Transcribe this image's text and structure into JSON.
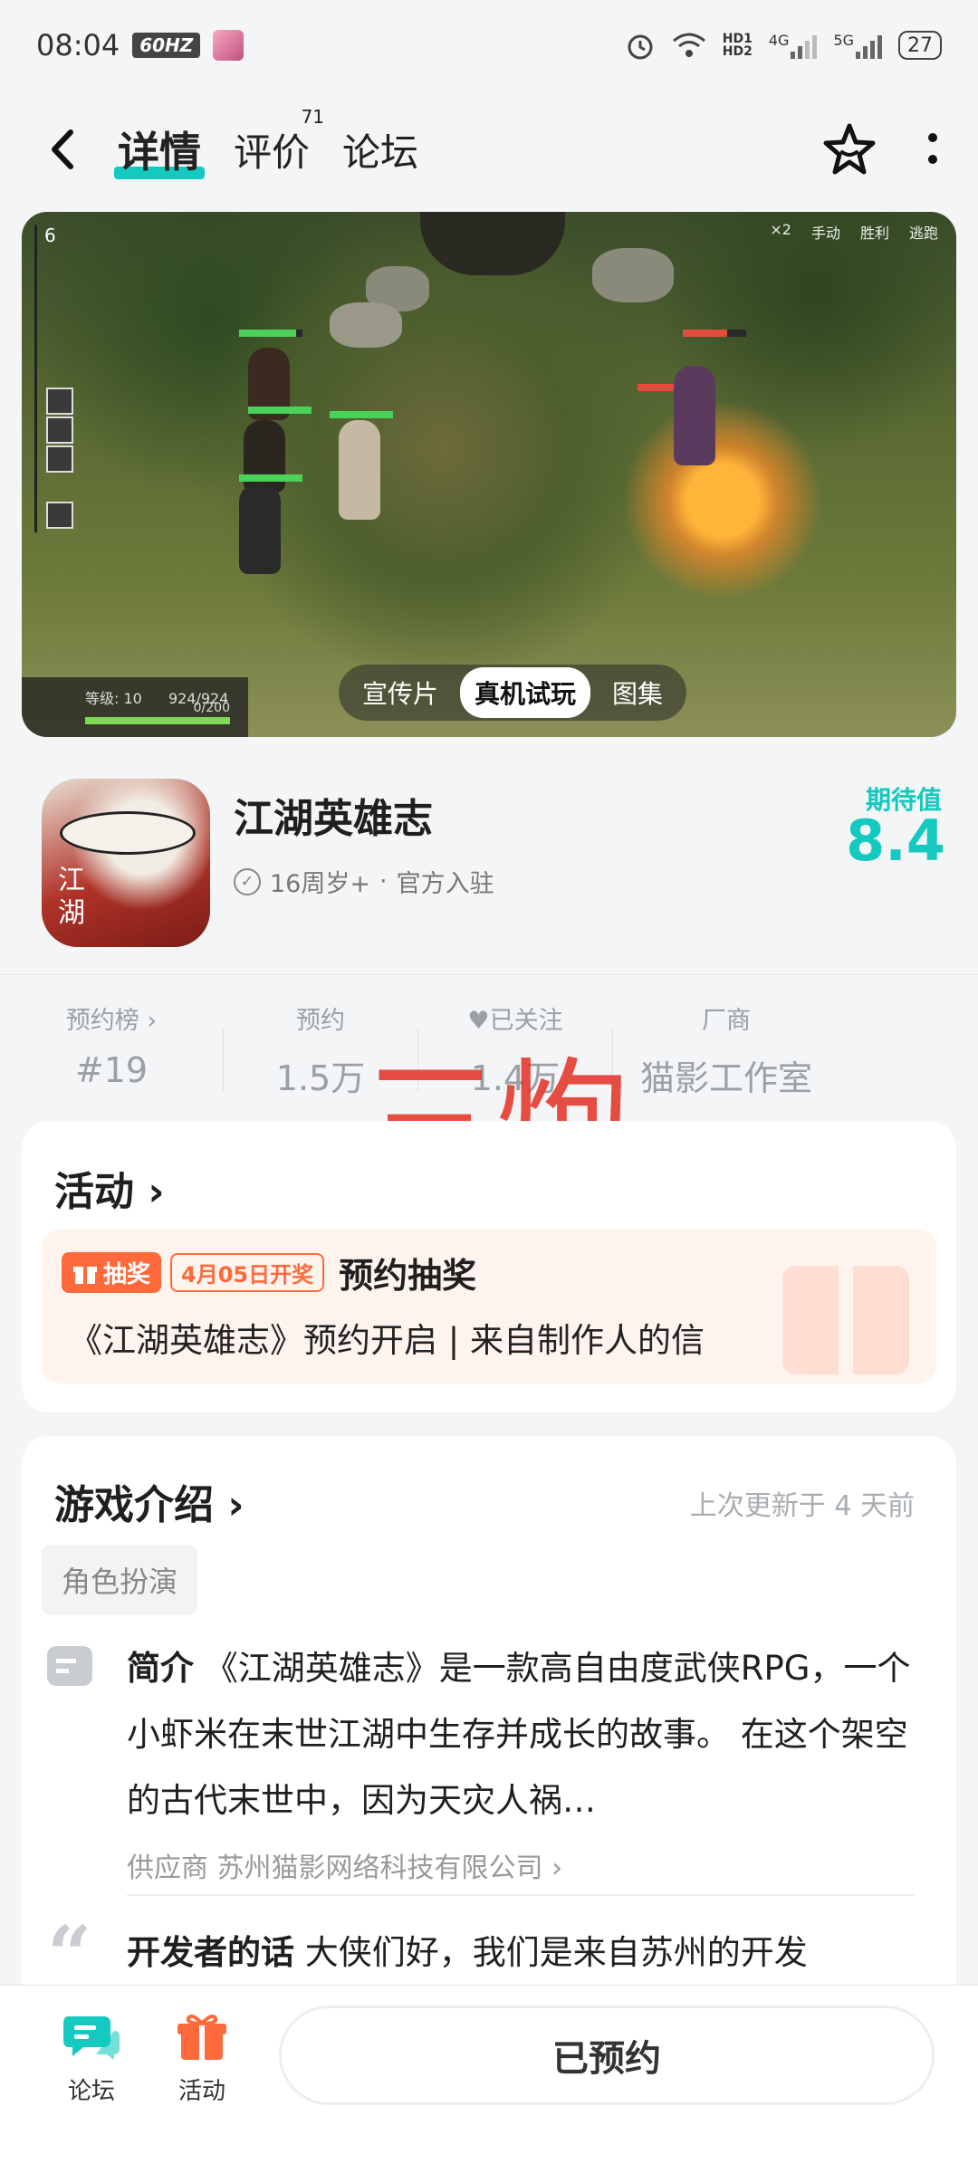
{
  "status_bar": {
    "time": "08:04",
    "refresh_rate": "60HZ",
    "network_1": "4G",
    "network_2": "5G",
    "hd_1": "HD1",
    "hd_2": "HD2",
    "battery": "27"
  },
  "nav": {
    "tabs": [
      {
        "label": "详情",
        "active": true
      },
      {
        "label": "评价",
        "badge": "71"
      },
      {
        "label": "论坛"
      }
    ]
  },
  "banner": {
    "media_tabs": [
      "宣传片",
      "真机试玩",
      "图集"
    ],
    "active_media_tab": "真机试玩",
    "hud": {
      "wave": "6",
      "top_stats": [
        "×2",
        "手动",
        "胜利",
        "逃跑"
      ],
      "level_label": "等级: 10",
      "hp": "924/924",
      "xp": "0/200"
    }
  },
  "app": {
    "title": "江湖英雄志",
    "icon_text": "江湖",
    "age_rating": "16周岁+",
    "separator": "·",
    "official": "官方入驻",
    "rating_label": "期待值",
    "rating_value": "8.4",
    "accent_color": "#14c9bf"
  },
  "stats": [
    {
      "label": "预约榜 ›",
      "value": "#19"
    },
    {
      "label": "预约",
      "value": "1.5万"
    },
    {
      "label": "♥已关注",
      "value": "1.4万"
    },
    {
      "label": "厂商",
      "value": "猫影工作室"
    }
  ],
  "watermark": "三炮",
  "activity": {
    "title": "活动 ›",
    "tag_label": "抽奖",
    "date_tag": "4月05日开奖",
    "promo_title": "预约抽奖",
    "promo_desc": "《江湖英雄志》预约开启 | 来自制作人的信",
    "tag_color": "#ff6a3d"
  },
  "intro": {
    "title": "游戏介绍 ›",
    "updated": "上次更新于 4 天前",
    "genre": "角色扮演",
    "summary_label": "简介",
    "summary": "《江湖英雄志》是一款高自由度武侠RPG，一个小虾米在末世江湖中生存并成长的故事。 在这个架空的古代末世中，因为天灾人祸…",
    "supplier": "供应商 苏州猫影网络科技有限公司 ›",
    "dev_label": "开发者的话",
    "dev_text": "大侠们好，我们是来自苏州的开发"
  },
  "bottom_bar": {
    "forum_label": "论坛",
    "activity_label": "活动",
    "reserve_label": "已预约"
  }
}
